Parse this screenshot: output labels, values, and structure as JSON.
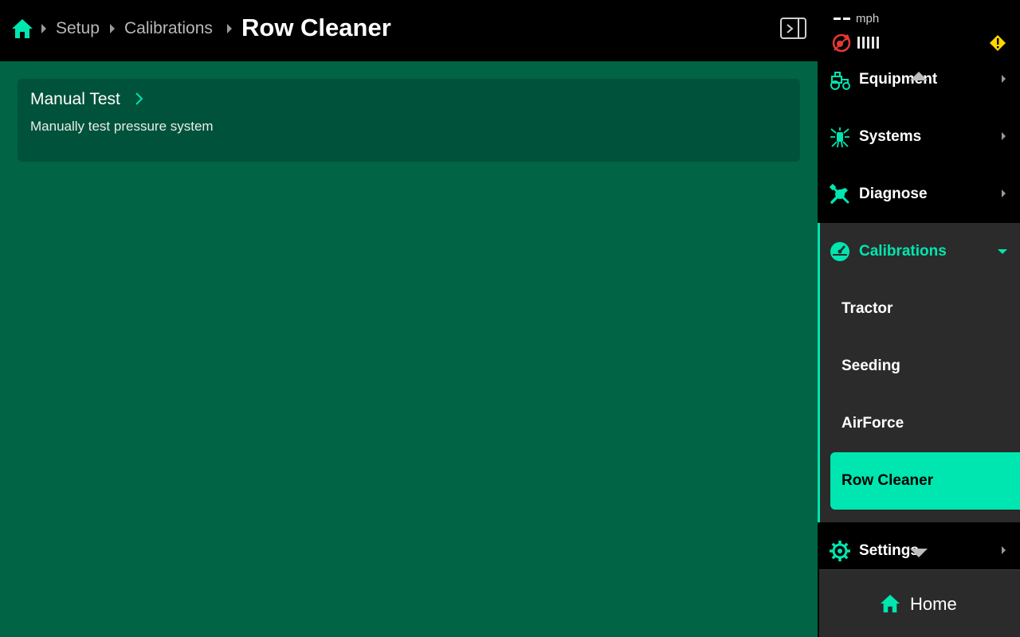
{
  "breadcrumb": {
    "items": [
      "Setup",
      "Calibrations"
    ],
    "current": "Row Cleaner"
  },
  "main": {
    "card": {
      "title": "Manual Test",
      "description": "Manually test pressure system"
    }
  },
  "status": {
    "speed_value": "--",
    "speed_unit": "mph",
    "icons": [
      "gps-off-icon",
      "signal-bars-icon",
      "warning-icon"
    ]
  },
  "sidebar": {
    "items": [
      {
        "label": "Equipment",
        "icon": "tractor-icon"
      },
      {
        "label": "Systems",
        "icon": "systems-icon"
      },
      {
        "label": "Diagnose",
        "icon": "wrench-screwdriver-icon"
      },
      {
        "label": "Calibrations",
        "icon": "gauge-icon"
      },
      {
        "label": "Settings",
        "icon": "gear-icon"
      }
    ],
    "calibrations_sub": [
      {
        "label": "Tractor"
      },
      {
        "label": "Seeding"
      },
      {
        "label": "AirForce"
      },
      {
        "label": "Row Cleaner"
      }
    ],
    "home_label": "Home"
  },
  "colors": {
    "accent": "#00e6b0",
    "main_bg": "#006445",
    "card_bg": "#00523a",
    "warning": "#ffd700",
    "gps_error": "#e53935"
  }
}
